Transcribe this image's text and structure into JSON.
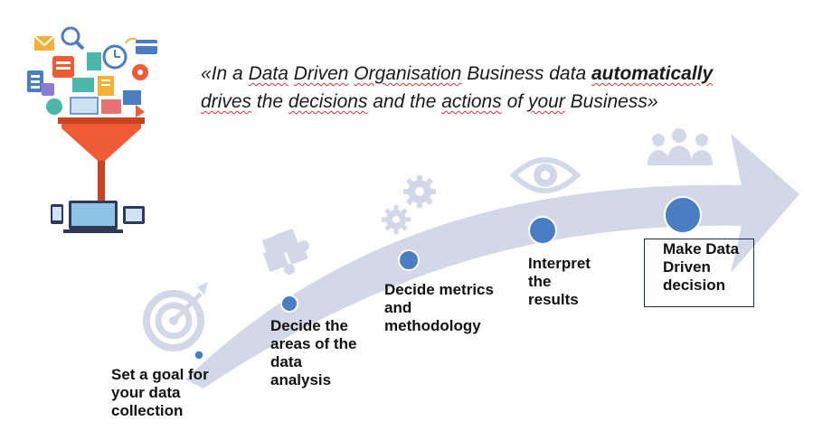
{
  "quote": {
    "open": "«",
    "seg1": "In a ",
    "seg2": "Data",
    "seg3": " ",
    "seg4": "Driven",
    "seg5": " ",
    "seg6": "Organisation",
    "seg7": " Business data ",
    "seg8": "automatically",
    "seg9": "drives",
    "seg10": " the ",
    "seg11": "decisions",
    "seg12": " and the ",
    "seg13": "actions",
    "seg14": " of ",
    "seg15": "your",
    "seg16": " Business",
    "close": "»"
  },
  "steps": [
    {
      "label": "Set a goal for\nyour data\ncollection"
    },
    {
      "label": "Decide the\nareas of the\ndata\nanalysis"
    },
    {
      "label": "Decide metrics\nand\nmethodology"
    },
    {
      "label": "Interpret\nthe\nresults"
    },
    {
      "label": "Make Data\nDriven\ndecision"
    }
  ],
  "colors": {
    "arrow": "#d3d8e8",
    "marker": "#4a7ec3",
    "icon": "#d3d8e8",
    "funnel": "#ee5b34",
    "text": "#111111"
  },
  "icons": [
    "target-icon",
    "puzzle-icon",
    "gears-icon",
    "eye-icon",
    "people-icon",
    "data-funnel-icon"
  ]
}
